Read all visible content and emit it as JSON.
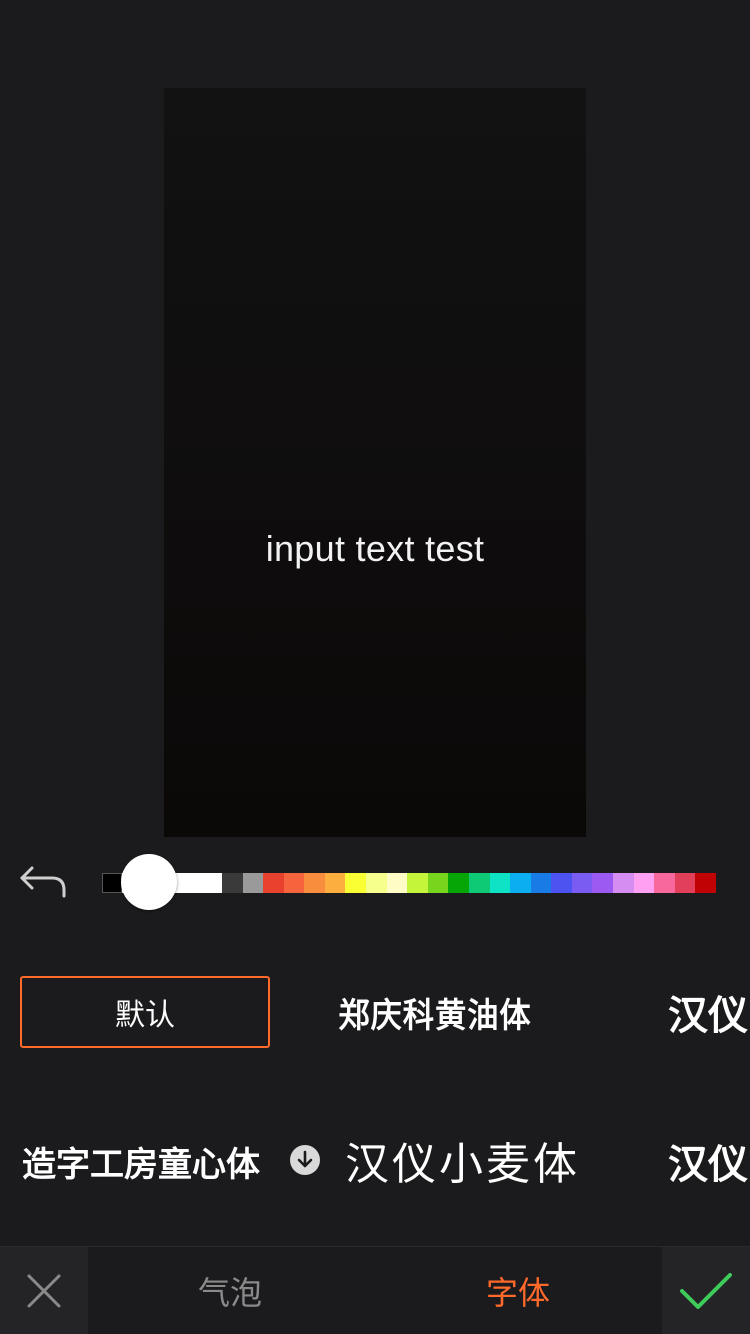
{
  "preview": {
    "overlay_text": "input text test"
  },
  "color_picker": {
    "swatches": [
      "#000000",
      "#ffffff",
      "#3a3a3a",
      "#9a9a9a",
      "#e8412d",
      "#f5643c",
      "#f88d3e",
      "#fcae3f",
      "#faff34",
      "#f6ff8c",
      "#fffcc6",
      "#c4f53a",
      "#77d51d",
      "#05a605",
      "#0fca75",
      "#0fe3c5",
      "#0baef0",
      "#197ce6",
      "#4d53f0",
      "#7a5cf2",
      "#9d5af3",
      "#d68df2",
      "#ffa0f2",
      "#f8689d",
      "#e23f5a",
      "#c10203"
    ],
    "selected_color": "#ffffff"
  },
  "fonts": {
    "row1": {
      "default_label": "默认",
      "zhengqingke_label": "郑庆科黄油体",
      "hanyi_partial_label": "汉仪"
    },
    "row2": {
      "zaozigongfang_label": "造字工房童心体",
      "hanyi_xiaomai_label": "汉仪小麦体",
      "hanyi_partial_label": "汉仪"
    }
  },
  "tabs": {
    "bubble_label": "气泡",
    "font_label": "字体",
    "active": "font"
  },
  "colors": {
    "accent": "#ff6a2b",
    "confirm": "#3ecb5a",
    "cancel": "#8a8a8a"
  }
}
